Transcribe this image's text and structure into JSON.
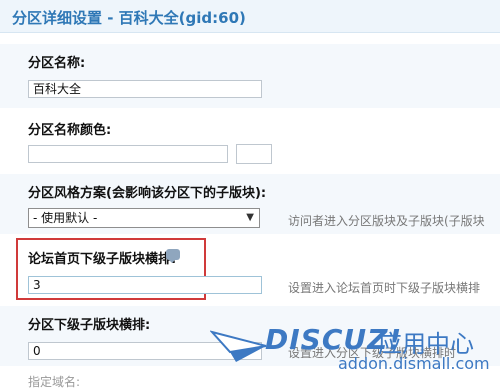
{
  "header": {
    "title": "分区详细设置 - 百科大全(gid:60)"
  },
  "form": {
    "name": {
      "label": "分区名称:",
      "value": "百科大全"
    },
    "name_color": {
      "label": "分区名称颜色:",
      "value": ""
    },
    "style": {
      "label": "分区风格方案(会影响该分区下的子版块):",
      "selected": "- 使用默认 -",
      "hint": "访问者进入分区版块及子版块(子版块"
    },
    "index_cols": {
      "label": "论坛首页下级子版块横排:",
      "value": "3",
      "hint": "设置进入论坛首页时下级子版块横排"
    },
    "sub_cols": {
      "label": "分区下级子版块横排:",
      "value": "0",
      "hint": "设置进入分区下级子版块横排时"
    },
    "next_label": "指定域名:"
  },
  "watermark": {
    "logo": "DISCUZ!",
    "subtitle": "应用中心",
    "url": "addon.dismall.com"
  },
  "colors": {
    "accent": "#2f78b6",
    "highlight": "#d03a3a",
    "watermark": "#3d79c3"
  }
}
